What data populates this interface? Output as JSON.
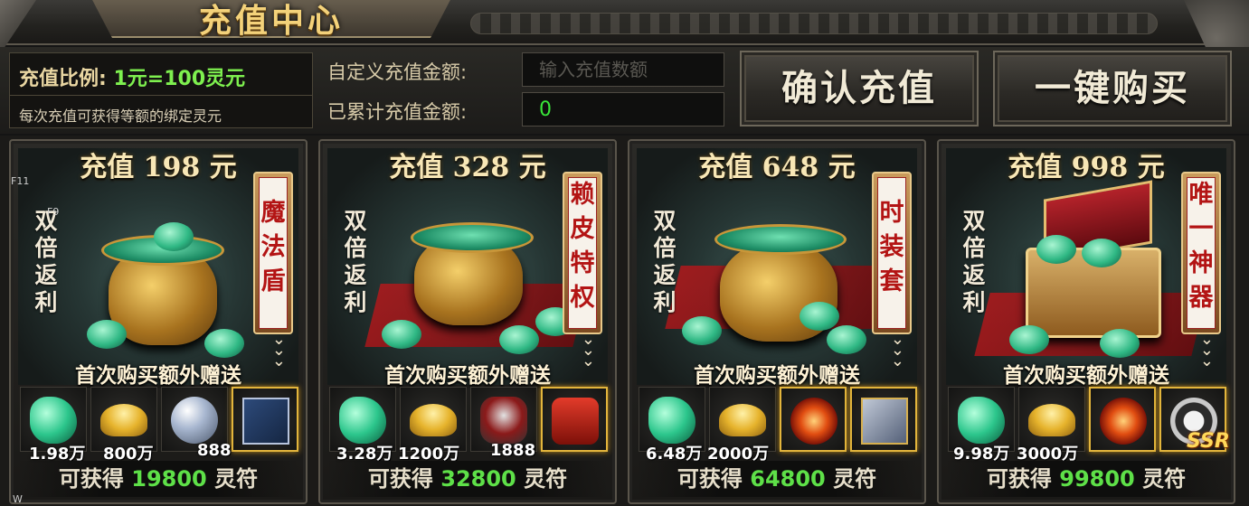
{
  "header": {
    "title": "充值中心"
  },
  "info": {
    "ratio_label": "充值比例:",
    "ratio_value": "1元=100灵元",
    "ratio_note": "每次充值可获得等额的绑定灵元",
    "custom_label": "自定义充值金额:",
    "custom_placeholder": "输入充值数额",
    "accum_label": "已累计充值金额:",
    "accum_value": "0"
  },
  "buttons": {
    "confirm": "确认充值",
    "one_click": "一键购买"
  },
  "common": {
    "double_tag": [
      "双",
      "倍",
      "返",
      "利"
    ],
    "promo": "首次购买额外赠送",
    "reward_prefix": "可获得",
    "reward_suffix": "灵符",
    "ssr": "SSR"
  },
  "cards": [
    {
      "title": "充值 198 元",
      "bonus": [
        "魔",
        "法",
        "盾"
      ],
      "items": [
        {
          "icon": "jade-icon",
          "qty": "1.98万"
        },
        {
          "icon": "gold-ingot-icon",
          "qty": "800万"
        },
        {
          "icon": "crystal-stone-icon",
          "qty": "888"
        },
        {
          "icon": "skill-book-icon",
          "qty": ""
        }
      ],
      "reward": "19800"
    },
    {
      "title": "充值 328 元",
      "bonus": [
        "赖",
        "皮",
        "特",
        "权"
      ],
      "items": [
        {
          "icon": "jade-icon",
          "qty": "3.28万"
        },
        {
          "icon": "gold-ingot-icon",
          "qty": "1200万"
        },
        {
          "icon": "armor-icon",
          "qty": "1888"
        },
        {
          "icon": "scroll-icon",
          "qty": ""
        }
      ],
      "reward": "32800"
    },
    {
      "title": "充值 648 元",
      "bonus": [
        "时",
        "装",
        "套"
      ],
      "items": [
        {
          "icon": "jade-icon",
          "qty": "6.48万"
        },
        {
          "icon": "gold-ingot-icon",
          "qty": "2000万"
        },
        {
          "icon": "fire-orb-icon",
          "qty": ""
        },
        {
          "icon": "treasure-box-icon",
          "qty": ""
        }
      ],
      "reward": "64800"
    },
    {
      "title": "充值 998 元",
      "bonus": [
        "唯",
        "一",
        "神",
        "器"
      ],
      "items": [
        {
          "icon": "jade-icon",
          "qty": "9.98万"
        },
        {
          "icon": "gold-ingot-icon",
          "qty": "3000万"
        },
        {
          "icon": "fire-orb-icon",
          "qty": ""
        },
        {
          "icon": "taiji-icon",
          "qty": ""
        }
      ],
      "reward": "99800"
    }
  ],
  "debug": {
    "f11": "F11",
    "f9": "F9",
    "w": "W"
  }
}
